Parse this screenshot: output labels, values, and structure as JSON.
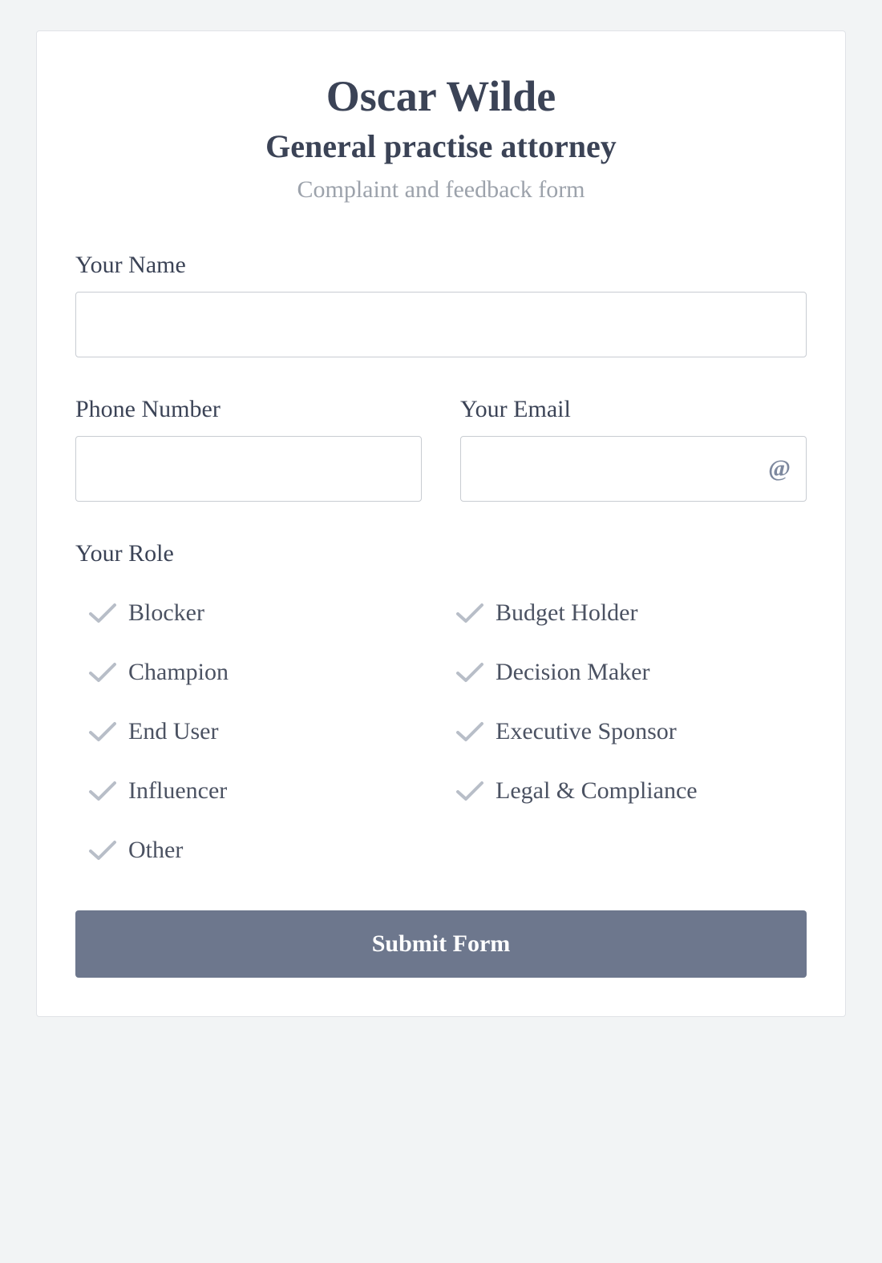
{
  "header": {
    "title": "Oscar Wilde",
    "subtitle": "General practise attorney",
    "description": "Complaint and feedback form"
  },
  "fields": {
    "name": {
      "label": "Your Name",
      "value": ""
    },
    "phone": {
      "label": "Phone Number",
      "value": ""
    },
    "email": {
      "label": "Your Email",
      "value": "",
      "icon": "@"
    },
    "role": {
      "label": "Your Role",
      "options": [
        "Blocker",
        "Budget Holder",
        "Champion",
        "Decision Maker",
        "End User",
        "Executive Sponsor",
        "Influencer",
        "Legal & Compliance",
        "Other"
      ]
    }
  },
  "submit": {
    "label": "Submit Form"
  }
}
